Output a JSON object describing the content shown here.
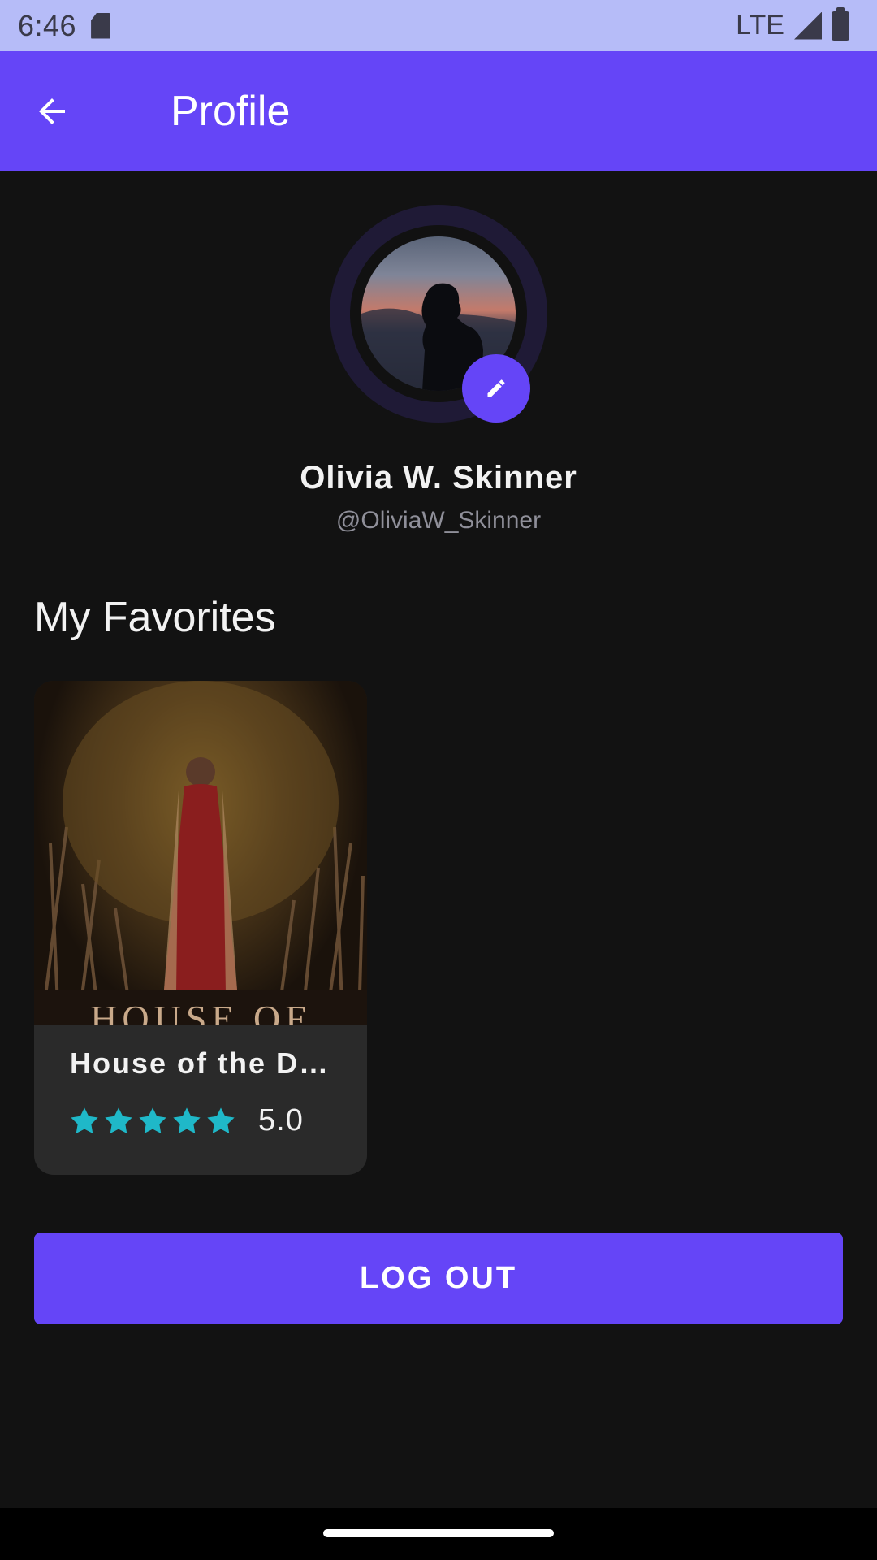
{
  "status_bar": {
    "time": "6:46",
    "network": "LTE",
    "icons": [
      "sd-card-icon",
      "signal-icon",
      "battery-icon"
    ]
  },
  "app_bar": {
    "title": "Profile",
    "back_icon": "arrow-back-icon"
  },
  "profile": {
    "name": "Olivia W. Skinner",
    "handle": "@OliviaW_Skinner",
    "edit_icon": "pencil-icon"
  },
  "favorites": {
    "section_title": "My Favorites",
    "items": [
      {
        "title": "House of the D…",
        "poster_text": "HOUSE OF",
        "rating": "5.0",
        "stars": 5
      }
    ]
  },
  "actions": {
    "logout_label": "LOG OUT"
  },
  "colors": {
    "primary": "#6545f7",
    "status_bar": "#b6bcf8",
    "background": "#121212",
    "card": "#2a2a2a",
    "star": "#1fb8c8"
  }
}
